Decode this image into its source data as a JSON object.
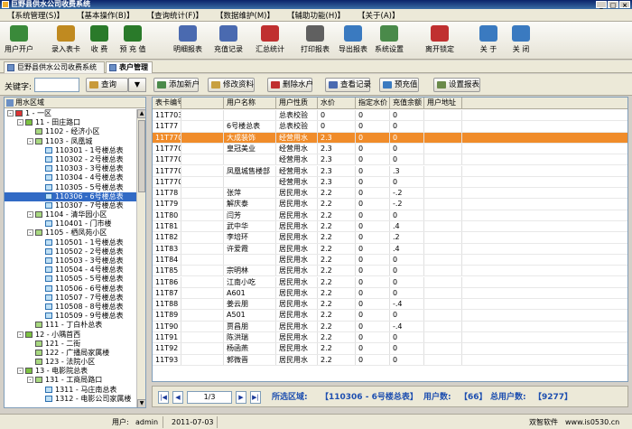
{
  "window": {
    "title": "巨野县供水公司收费系统"
  },
  "menu": [
    "【系统管理(S)】",
    "【基本操作(B)】",
    "【查询统计(F)】",
    "【数据维护(M)】",
    "【辅助功能(H)】",
    "【关于(A)】"
  ],
  "toolbar": [
    {
      "label": "用户开户",
      "icon": "user-add-icon",
      "color": "#3a8a3a"
    },
    {
      "label": "录入表卡",
      "icon": "card-edit-icon",
      "color": "#c08a20"
    },
    {
      "label": "收 费",
      "icon": "money-icon",
      "color": "#2a7a2a"
    },
    {
      "label": "预 充 值",
      "icon": "deposit-icon",
      "color": "#2a7a2a"
    },
    {
      "label": "明细报表",
      "icon": "report-icon",
      "color": "#4a6ab0"
    },
    {
      "label": "充值记录",
      "icon": "record-icon",
      "color": "#4a6ab0"
    },
    {
      "label": "汇总统计",
      "icon": "chart-icon",
      "color": "#c03030"
    },
    {
      "label": "打印报表",
      "icon": "printer-icon",
      "color": "#606060"
    },
    {
      "label": "导出报表",
      "icon": "export-icon",
      "color": "#3a7ac0"
    },
    {
      "label": "系统设置",
      "icon": "settings-icon",
      "color": "#4a8a4a"
    },
    {
      "label": "离开锁定",
      "icon": "lock-icon",
      "color": "#c03030"
    },
    {
      "label": "关 于",
      "icon": "about-icon",
      "color": "#3a7ac0"
    },
    {
      "label": "关 闭",
      "icon": "close-icon",
      "color": "#3a7ac0"
    }
  ],
  "tabs": [
    "巨野县供水公司收费系统",
    "表户管理"
  ],
  "search": {
    "label": "关键字:",
    "value": "",
    "query_btn": "查询"
  },
  "actions": [
    "添加新户",
    "修改资料",
    "删除水户",
    "查看记录",
    "预充值",
    "设置报表"
  ],
  "tree": {
    "header": "用水区域",
    "nodes": [
      {
        "text": "1 - 一区",
        "level": 0,
        "sq": "red",
        "toggle": "-"
      },
      {
        "text": "11 - 田庄路口",
        "level": 1,
        "sq": "green",
        "toggle": "-"
      },
      {
        "text": "1102 - 经济小区",
        "level": 2,
        "sq": "lgreen",
        "toggle": ""
      },
      {
        "text": "1103 - 凤凰城",
        "level": 2,
        "sq": "lgreen",
        "toggle": "-"
      },
      {
        "text": "110301 - 1号楼总表",
        "level": 3,
        "sq": "blue",
        "toggle": ""
      },
      {
        "text": "110302 - 2号楼总表",
        "level": 3,
        "sq": "blue",
        "toggle": ""
      },
      {
        "text": "110303 - 3号楼总表",
        "level": 3,
        "sq": "blue",
        "toggle": ""
      },
      {
        "text": "110304 - 4号楼总表",
        "level": 3,
        "sq": "blue",
        "toggle": ""
      },
      {
        "text": "110305 - 5号楼总表",
        "level": 3,
        "sq": "blue",
        "toggle": ""
      },
      {
        "text": "110306 - 6号楼总表",
        "level": 3,
        "sq": "blue",
        "toggle": "",
        "selected": true
      },
      {
        "text": "110307 - 7号楼总表",
        "level": 3,
        "sq": "blue",
        "toggle": ""
      },
      {
        "text": "1104 - 清华园小区",
        "level": 2,
        "sq": "lgreen",
        "toggle": "-"
      },
      {
        "text": "110401 - 门市楼",
        "level": 3,
        "sq": "blue",
        "toggle": ""
      },
      {
        "text": "1105 - 栖凤苑小区",
        "level": 2,
        "sq": "lgreen",
        "toggle": "-"
      },
      {
        "text": "110501 - 1号楼总表",
        "level": 3,
        "sq": "blue",
        "toggle": ""
      },
      {
        "text": "110502 - 2号楼总表",
        "level": 3,
        "sq": "blue",
        "toggle": ""
      },
      {
        "text": "110503 - 3号楼总表",
        "level": 3,
        "sq": "blue",
        "toggle": ""
      },
      {
        "text": "110504 - 4号楼总表",
        "level": 3,
        "sq": "blue",
        "toggle": ""
      },
      {
        "text": "110505 - 5号楼总表",
        "level": 3,
        "sq": "blue",
        "toggle": ""
      },
      {
        "text": "110506 - 6号楼总表",
        "level": 3,
        "sq": "blue",
        "toggle": ""
      },
      {
        "text": "110507 - 7号楼总表",
        "level": 3,
        "sq": "blue",
        "toggle": ""
      },
      {
        "text": "110508 - 8号楼总表",
        "level": 3,
        "sq": "blue",
        "toggle": ""
      },
      {
        "text": "110509 - 9号楼总表",
        "level": 3,
        "sq": "blue",
        "toggle": ""
      },
      {
        "text": "111 - 丁白朴总表",
        "level": 2,
        "sq": "lgreen",
        "toggle": ""
      },
      {
        "text": "12 - 小隅首西",
        "level": 1,
        "sq": "green",
        "toggle": "-"
      },
      {
        "text": "121 - 二街",
        "level": 2,
        "sq": "lgreen",
        "toggle": ""
      },
      {
        "text": "122 - 广播局家属楼",
        "level": 2,
        "sq": "lgreen",
        "toggle": ""
      },
      {
        "text": "123 - 法院小区",
        "level": 2,
        "sq": "lgreen",
        "toggle": ""
      },
      {
        "text": "13 - 电影院总表",
        "level": 1,
        "sq": "green",
        "toggle": "-"
      },
      {
        "text": "131 - 工商局路口",
        "level": 2,
        "sq": "lgreen",
        "toggle": "-"
      },
      {
        "text": "1311 - 马庄南总表",
        "level": 3,
        "sq": "blue",
        "toggle": ""
      },
      {
        "text": "1312 - 电影公司家属楼",
        "level": 3,
        "sq": "blue",
        "toggle": ""
      }
    ]
  },
  "grid": {
    "headers": [
      "表卡编号",
      "",
      "用户名称",
      "用户性质",
      "水价",
      "指定水价",
      "充值余额",
      "用户地址"
    ],
    "rows": [
      [
        "11T703",
        "",
        "",
        "总表校验",
        "0",
        "0",
        "0",
        ""
      ],
      [
        "11T77",
        "",
        "6号楼总表",
        "总表校验",
        "0",
        "0",
        "0",
        ""
      ],
      [
        "11T7701",
        "",
        "大成装饰",
        "经营用水",
        "2.3",
        "0",
        "0",
        ""
      ],
      [
        "11T7702",
        "",
        "皇冠美业",
        "经营用水",
        "2.3",
        "0",
        "0",
        ""
      ],
      [
        "11T7703",
        "",
        "",
        "经营用水",
        "2.3",
        "0",
        "0",
        ""
      ],
      [
        "11T7704",
        "",
        "凤凰城售楼部",
        "经营用水",
        "2.3",
        "0",
        ".3",
        ""
      ],
      [
        "11T7705",
        "",
        "",
        "经营用水",
        "2.3",
        "0",
        "0",
        ""
      ],
      [
        "11T78",
        "",
        "张萍",
        "居民用水",
        "2.2",
        "0",
        "-.2",
        ""
      ],
      [
        "11T79",
        "",
        "解庆泰",
        "居民用水",
        "2.2",
        "0",
        "-.2",
        ""
      ],
      [
        "11T80",
        "",
        "闫芳",
        "居民用水",
        "2.2",
        "0",
        "0",
        ""
      ],
      [
        "11T81",
        "",
        "武中华",
        "居民用水",
        "2.2",
        "0",
        ".4",
        ""
      ],
      [
        "11T82",
        "",
        "李培环",
        "居民用水",
        "2.2",
        "0",
        ".2",
        ""
      ],
      [
        "11T83",
        "",
        "许爱霞",
        "居民用水",
        "2.2",
        "0",
        ".4",
        ""
      ],
      [
        "11T84",
        "",
        "",
        "居民用水",
        "2.2",
        "0",
        "0",
        ""
      ],
      [
        "11T85",
        "",
        "宗明林",
        "居民用水",
        "2.2",
        "0",
        "0",
        ""
      ],
      [
        "11T86",
        "",
        "江南小吃",
        "居民用水",
        "2.2",
        "0",
        "0",
        ""
      ],
      [
        "11T87",
        "",
        "A601",
        "居民用水",
        "2.2",
        "0",
        "0",
        ""
      ],
      [
        "11T88",
        "",
        "姜云朋",
        "居民用水",
        "2.2",
        "0",
        "-.4",
        ""
      ],
      [
        "11T89",
        "",
        "A501",
        "居民用水",
        "2.2",
        "0",
        "0",
        ""
      ],
      [
        "11T90",
        "",
        "贾昌朋",
        "居民用水",
        "2.2",
        "0",
        "-.4",
        ""
      ],
      [
        "11T91",
        "",
        "陈洪瑞",
        "居民用水",
        "2.2",
        "0",
        "0",
        ""
      ],
      [
        "11T92",
        "",
        "杨函燕",
        "居民用水",
        "2.2",
        "0",
        "0",
        ""
      ],
      [
        "11T93",
        "",
        "郭微晋",
        "居民用水",
        "2.2",
        "0",
        "0",
        ""
      ]
    ],
    "highlight_row": 2,
    "highlight_color": "#f08c2a"
  },
  "pager": {
    "page": "1/3",
    "area_label": "所选区域:",
    "area_value": "【110306 - 6号楼总表】",
    "users_label": "用户数:",
    "users_value": "【66】",
    "total_label": "总用户数:",
    "total_value": "【9277】"
  },
  "status": {
    "user_label": "用户:",
    "user_value": "admin",
    "date": "2011-07-03",
    "vendor": "双智软件",
    "site": "www.is0530.cn"
  }
}
